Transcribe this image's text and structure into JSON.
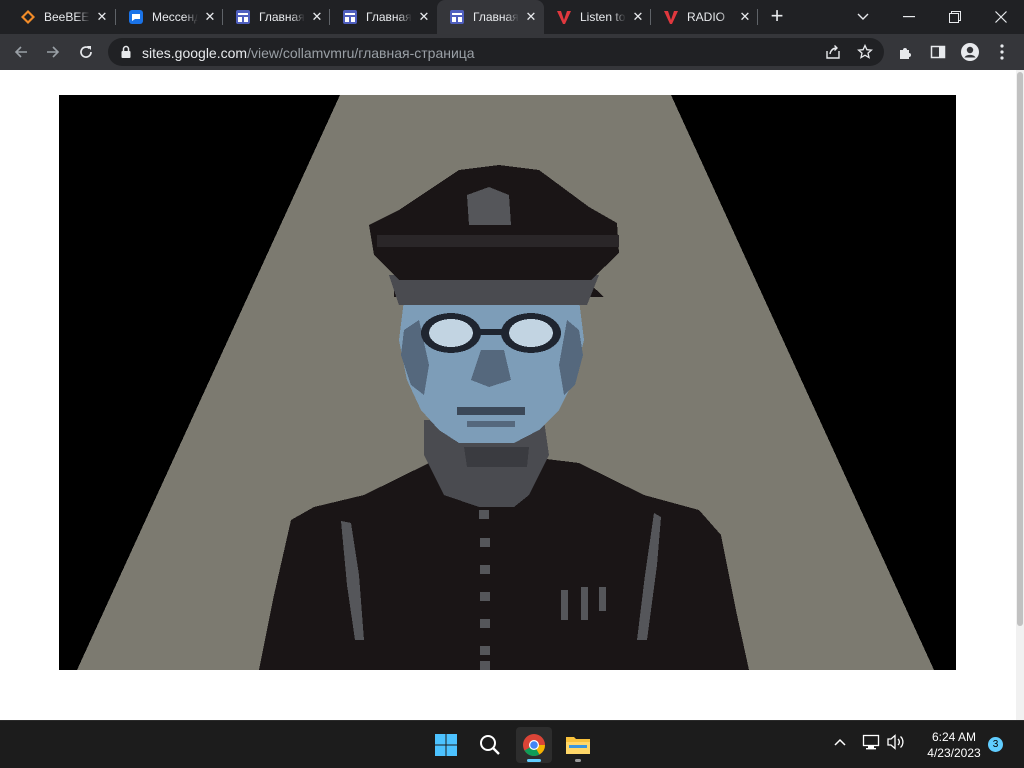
{
  "tabs": [
    {
      "title": "BeeBEEP",
      "icon": "beebeep-icon",
      "active": false
    },
    {
      "title": "Мессенджер",
      "icon": "messenger-icon",
      "active": false
    },
    {
      "title": "Главная страница",
      "icon": "google-sites-icon",
      "active": false
    },
    {
      "title": "Главная страница",
      "icon": "google-sites-icon",
      "active": false
    },
    {
      "title": "Главная страница",
      "icon": "google-sites-icon",
      "active": true
    },
    {
      "title": "Listen to",
      "icon": "v-logo-icon",
      "active": false
    },
    {
      "title": "RADIO",
      "icon": "v-logo-icon",
      "active": false
    }
  ],
  "address_bar": {
    "host": "sites.google.com",
    "path": "/view/collamvmru/главная-страница"
  },
  "page": {
    "image_label": "pixel-art officer in cap and round glasses under a spotlight"
  },
  "taskbar": {
    "apps": [
      "windows-start",
      "search",
      "chrome",
      "file-explorer"
    ],
    "time": "6:24 AM",
    "date": "4/23/2023",
    "notification_count": "3"
  },
  "colors": {
    "tabstrip": "#202124",
    "toolbar": "#35363a",
    "spotlight": "#7c7a70",
    "uniform": "#1a1516",
    "skin": "#7d9db8",
    "accent": "#60cdff"
  }
}
